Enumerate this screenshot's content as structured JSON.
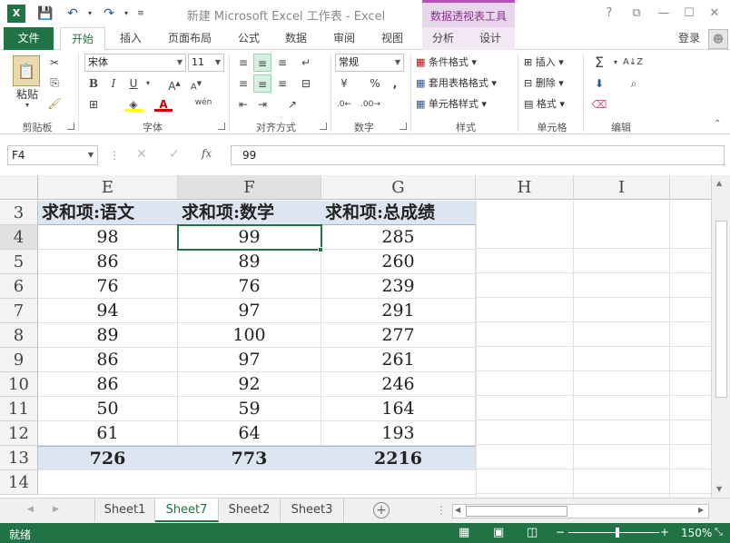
{
  "titlebar": {
    "title": "新建 Microsoft Excel 工作表 - Excel",
    "context_tab_title": "数据透视表工具",
    "help": "?",
    "restore": "⧉",
    "minimize": "—",
    "maximize": "☐",
    "close": "✕"
  },
  "tabs": {
    "file": "文件",
    "home": "开始",
    "insert": "插入",
    "page_layout": "页面布局",
    "formulas": "公式",
    "data": "数据",
    "review": "审阅",
    "view": "视图",
    "analyze": "分析",
    "design": "设计",
    "login": "登录"
  },
  "ribbon": {
    "clipboard": {
      "label": "剪贴板",
      "paste": "粘贴"
    },
    "font": {
      "label": "字体",
      "font_name": "宋体",
      "font_size": "11"
    },
    "alignment": {
      "label": "对齐方式"
    },
    "number": {
      "label": "数字",
      "format": "常规"
    },
    "styles": {
      "label": "样式",
      "conditional": "条件格式",
      "table_format": "套用表格格式",
      "cell_styles": "单元格样式"
    },
    "cells": {
      "label": "单元格",
      "insert": "插入",
      "delete": "删除",
      "format": "格式"
    },
    "editing": {
      "label": "编辑"
    }
  },
  "formula_bar": {
    "name_box": "F4",
    "cancel": "✕",
    "enter": "✓",
    "fx": "fx",
    "value": "99"
  },
  "grid": {
    "columns": [
      "E",
      "F",
      "G",
      "H",
      "I"
    ],
    "rows": [
      "3",
      "4",
      "5",
      "6",
      "7",
      "8",
      "9",
      "10",
      "11",
      "12",
      "13",
      "14"
    ],
    "headers": [
      "求和项:语文",
      "求和项:数学",
      "求和项:总成绩"
    ],
    "data": [
      [
        "98",
        "99",
        "285"
      ],
      [
        "86",
        "89",
        "260"
      ],
      [
        "76",
        "76",
        "239"
      ],
      [
        "94",
        "97",
        "291"
      ],
      [
        "89",
        "100",
        "277"
      ],
      [
        "86",
        "97",
        "261"
      ],
      [
        "86",
        "92",
        "246"
      ],
      [
        "50",
        "59",
        "164"
      ],
      [
        "61",
        "64",
        "193"
      ]
    ],
    "totals": [
      "726",
      "773",
      "2216"
    ]
  },
  "sheets": [
    "Sheet1",
    "Sheet7",
    "Sheet2",
    "Sheet3"
  ],
  "active_sheet": "Sheet7",
  "status": {
    "ready": "就绪",
    "zoom": "150%"
  },
  "colors": {
    "accent": "#217346",
    "pivot_header": "#dde6f0",
    "context_tab": "#8a2f8e"
  }
}
